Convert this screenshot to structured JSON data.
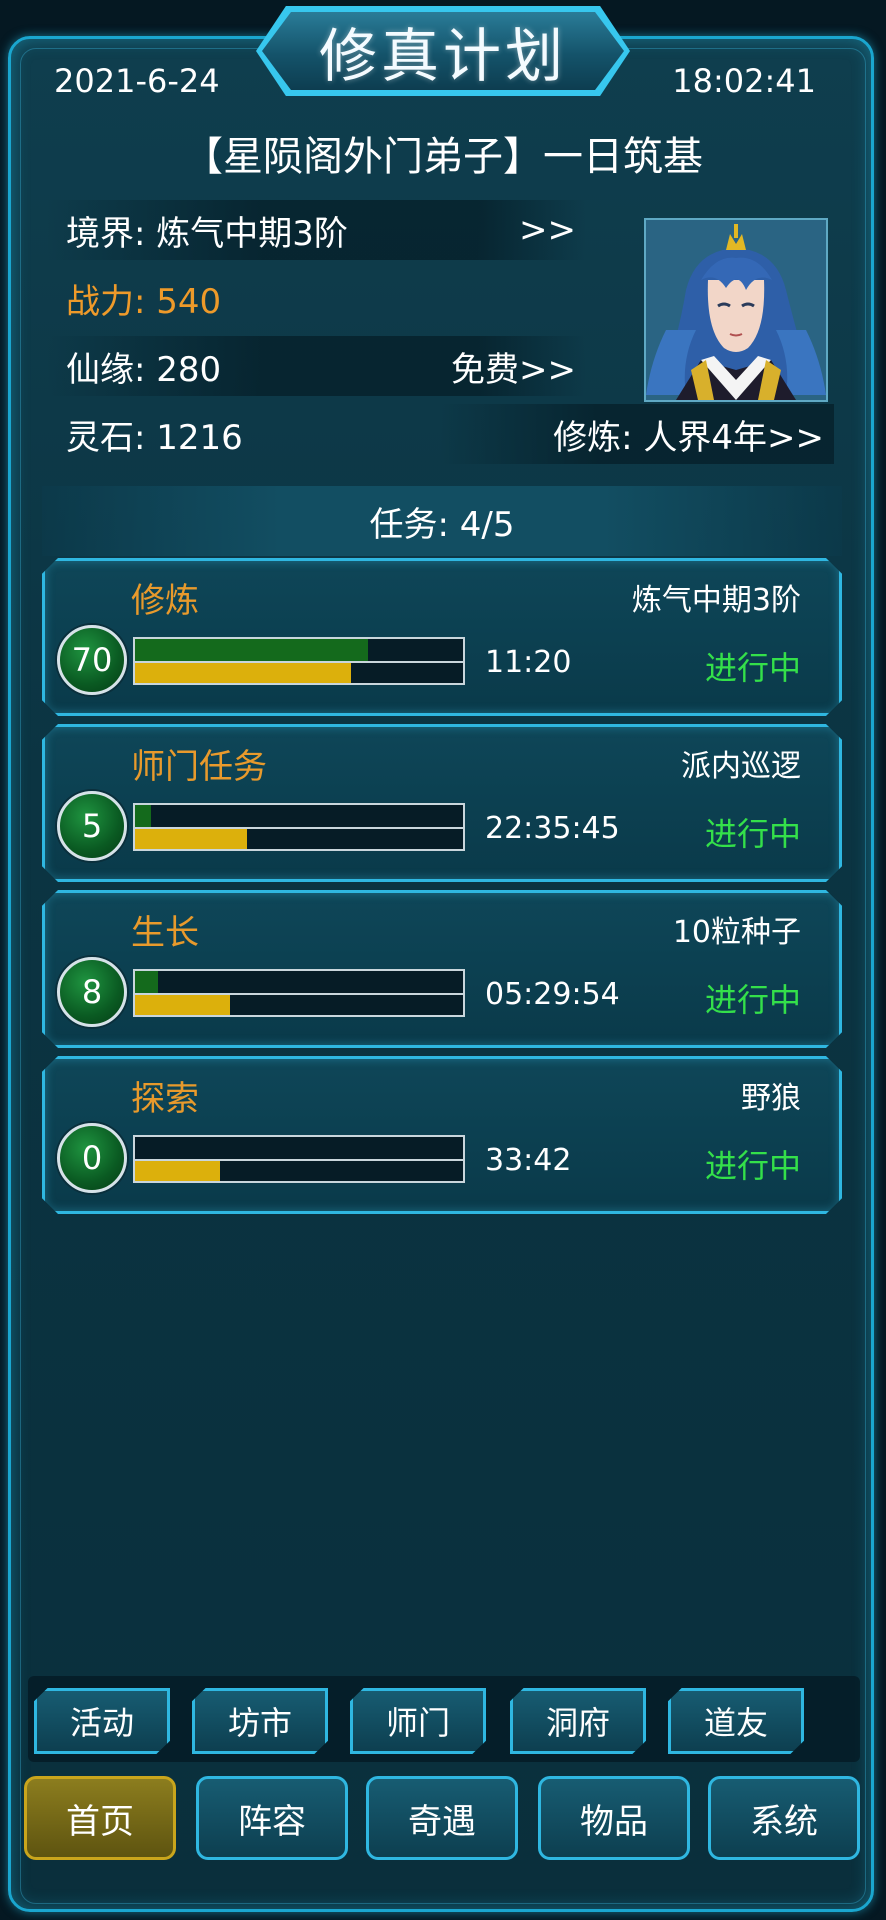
{
  "header": {
    "title": "修真计划",
    "date": "2021-6-24",
    "time": "18:02:41",
    "headline": "【星陨阁外门弟子】一日筑基"
  },
  "stats": {
    "realm_label": "境界: 炼气中期3阶",
    "realm_arrow": ">>",
    "power_label": "战力: 540",
    "fate_label": "仙缘: 280",
    "fate_action": "免费>>",
    "stones_label": "灵石: 1216",
    "cultivate_label": "修炼: 人界4年>>"
  },
  "tasks": {
    "header": "任务: 4/5",
    "items": [
      {
        "title": "修炼",
        "target": "炼气中期3阶",
        "level": "70",
        "time": "11:20",
        "status": "进行中",
        "top_progress": 0.71,
        "bottom_progress": 0.66
      },
      {
        "title": "师门任务",
        "target": "派内巡逻",
        "level": "5",
        "time": "22:35:45",
        "status": "进行中",
        "top_progress": 0.05,
        "bottom_progress": 0.34
      },
      {
        "title": "生长",
        "target": "10粒种子",
        "level": "8",
        "time": "05:29:54",
        "status": "进行中",
        "top_progress": 0.07,
        "bottom_progress": 0.29
      },
      {
        "title": "探索",
        "target": "野狼",
        "level": "0",
        "time": "33:42",
        "status": "进行中",
        "top_progress": 0.0,
        "bottom_progress": 0.26
      }
    ]
  },
  "sub_nav": [
    "活动",
    "坊市",
    "师门",
    "洞府",
    "道友"
  ],
  "main_nav": [
    "首页",
    "阵容",
    "奇遇",
    "物品",
    "系统"
  ],
  "colors": {
    "accent": "#2fb7e1",
    "power": "#ee9a2a",
    "task_title": "#e89a2c",
    "status": "#34e04a",
    "bar_top": "#146a1c",
    "bar_bottom": "#dcb00c",
    "active_tab": "#8c7d1e"
  }
}
